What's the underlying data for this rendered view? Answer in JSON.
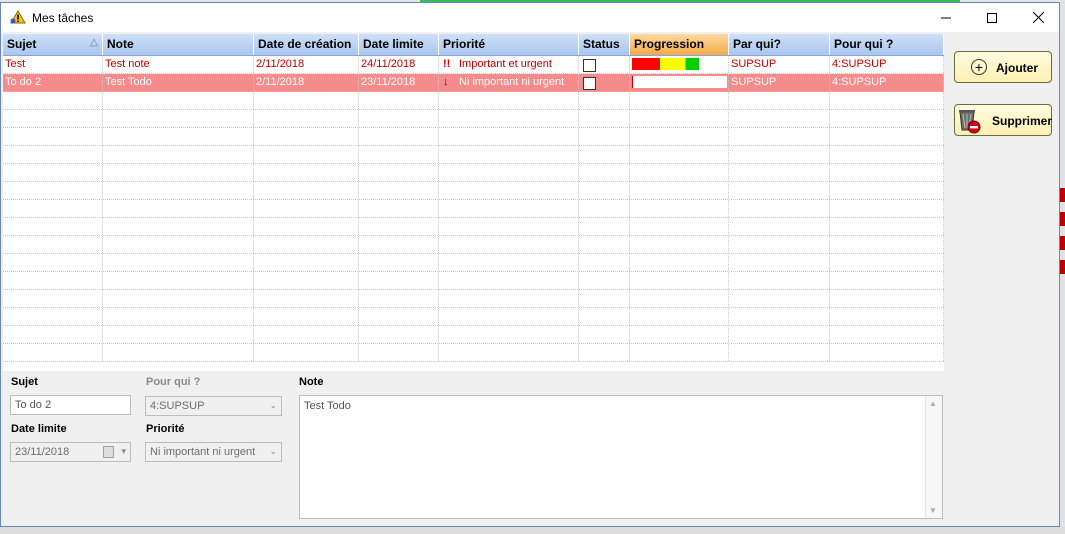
{
  "window": {
    "title": "Mes tâches"
  },
  "grid": {
    "columns": [
      {
        "label": "Sujet",
        "w": 100
      },
      {
        "label": "Note",
        "w": 151
      },
      {
        "label": "Date de création",
        "w": 105
      },
      {
        "label": "Date limite",
        "w": 80
      },
      {
        "label": "Priorité",
        "w": 140
      },
      {
        "label": "Status",
        "w": 51
      },
      {
        "label": "Progression",
        "w": 99
      },
      {
        "label": "Par qui?",
        "w": 101
      },
      {
        "label": "Pour qui ?",
        "w": 114
      }
    ],
    "rows": [
      {
        "sujet": "Test",
        "note": "Test note",
        "date_creation": "2/11/2018",
        "date_limite": "24/11/2018",
        "priorite": "Important et urgent",
        "priorite_icon": "!!",
        "status_checked": false,
        "progression": 0.7,
        "par_qui": "SUPSUP",
        "pour_qui": "4:SUPSUP",
        "selected": false
      },
      {
        "sujet": "To do 2",
        "note": "Test Todo",
        "date_creation": "2/11/2018",
        "date_limite": "23/11/2018",
        "priorite": "Ni important ni urgent",
        "priorite_icon": "↓",
        "status_checked": false,
        "progression": 0.0,
        "par_qui": "SUPSUP",
        "pour_qui": "4:SUPSUP",
        "selected": true
      }
    ]
  },
  "form": {
    "sujet_label": "Sujet",
    "sujet_value": "To do 2",
    "pour_qui_label": "Pour qui ?",
    "pour_qui_value": "4:SUPSUP",
    "date_limite_label": "Date limite",
    "date_limite_value": "23/11/2018",
    "priorite_label": "Priorité",
    "priorite_value": "Ni important ni urgent",
    "note_label": "Note",
    "note_value": "Test Todo"
  },
  "buttons": {
    "add": "Ajouter",
    "delete": "Supprimer"
  },
  "colors": {
    "row_selected": "#f58b8b",
    "row_text": "#c00000",
    "header": "#a9c6ef",
    "header_active": "#f3a94a",
    "button_bg": "#fdf0b3"
  }
}
